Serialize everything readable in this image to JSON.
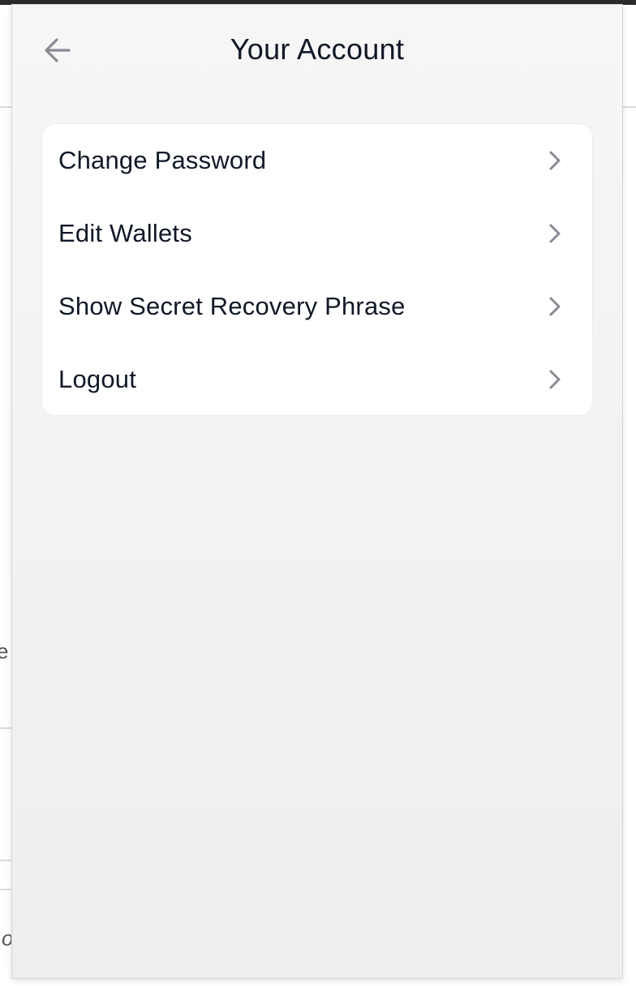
{
  "header": {
    "title": "Your Account",
    "back_icon": "arrow-left-icon"
  },
  "menu": {
    "items": [
      {
        "label": "Change Password",
        "icon": "chevron-right-icon"
      },
      {
        "label": "Edit Wallets",
        "icon": "chevron-right-icon"
      },
      {
        "label": "Show Secret Recovery Phrase",
        "icon": "chevron-right-icon"
      },
      {
        "label": "Logout",
        "icon": "chevron-right-icon"
      }
    ]
  },
  "background": {
    "partial_text_1": "e",
    "partial_text_2": "o"
  },
  "colors": {
    "text_primary": "#111827",
    "icon_gray": "#8a8a94",
    "card_bg": "#ffffff",
    "panel_bg": "#f3f3f5"
  }
}
